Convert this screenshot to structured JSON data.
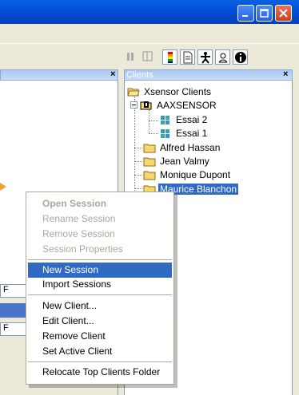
{
  "window": {
    "controls": {
      "minimize": "minimize-icon",
      "maximize": "maximize-icon",
      "close": "close-icon"
    }
  },
  "toolbar": {
    "icons": [
      "grip-icon",
      "layout-icon",
      "color-palette-icon",
      "document-icon",
      "person-icon",
      "user-badge-icon",
      "info-icon"
    ]
  },
  "left_pane": {
    "boxes": [
      "F",
      "F"
    ]
  },
  "clients_panel": {
    "title": "Clients",
    "tree": [
      {
        "label": "Xsensor Clients",
        "icon": "folder-open-icon"
      },
      {
        "label": "AAXSENSOR",
        "icon": "client-folder-icon"
      },
      {
        "label": "Essai 2",
        "icon": "session-icon"
      },
      {
        "label": "Essai 1",
        "icon": "session-icon"
      },
      {
        "label": "Alfred Hassan",
        "icon": "folder-icon"
      },
      {
        "label": "Jean Valmy",
        "icon": "folder-icon"
      },
      {
        "label": "Monique Dupont",
        "icon": "folder-icon"
      },
      {
        "label": "Maurice Blanchon",
        "icon": "folder-icon",
        "selected": true
      }
    ]
  },
  "context_menu": {
    "items": [
      {
        "label": "Open Session",
        "disabled": true,
        "bold": true
      },
      {
        "label": "Rename Session",
        "disabled": true
      },
      {
        "label": "Remove Session",
        "disabled": true
      },
      {
        "label": "Session Properties",
        "disabled": true
      },
      {
        "label": "New Session",
        "highlighted": true
      },
      {
        "label": "Import Sessions"
      },
      {
        "label": "New Client..."
      },
      {
        "label": "Edit Client..."
      },
      {
        "label": "Remove Client"
      },
      {
        "label": "Set Active Client"
      },
      {
        "label": "Relocate Top Clients Folder"
      }
    ]
  },
  "colors": {
    "titlebar": "#0450d8",
    "selection": "#316ac5",
    "disabled_text": "#aca899",
    "panel_header": "#a9c8f3"
  }
}
